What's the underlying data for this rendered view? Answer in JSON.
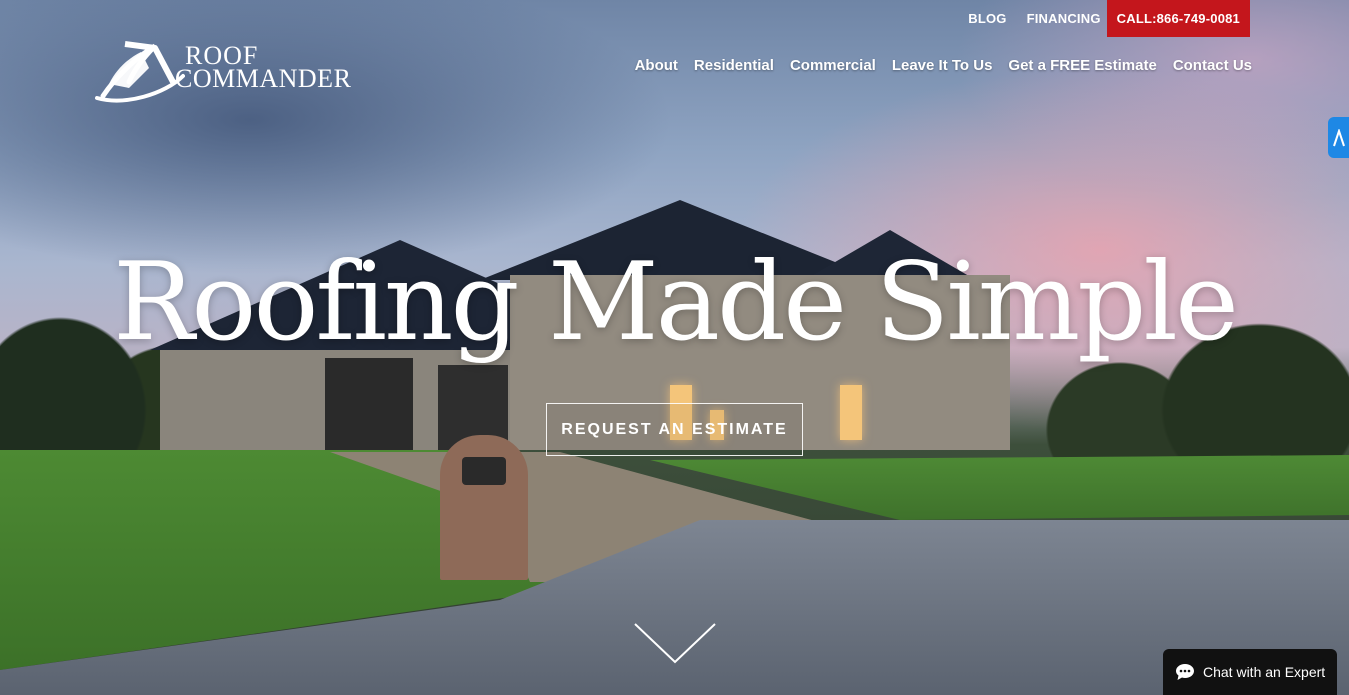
{
  "topbar": {
    "blog": "BLOG",
    "financing": "FINANCING",
    "call": "CALL:866-749-0081"
  },
  "logo": {
    "line1": "ROOF",
    "line2": "COMMANDER"
  },
  "nav": {
    "items": [
      "About",
      "Residential",
      "Commercial",
      "Leave It To Us",
      "Get a FREE Estimate",
      "Contact Us"
    ]
  },
  "hero": {
    "headline": "Roofing Made Simple",
    "cta": "REQUEST AN ESTIMATE"
  },
  "chat": {
    "label": "Chat with an Expert"
  },
  "colors": {
    "call_bg": "#c4161c",
    "side_tab": "#1e88e5",
    "chat_bg": "#111111"
  },
  "icons": [
    "chevron-down-icon",
    "chat-bubble-icon",
    "accessibility-icon",
    "roof-logo-icon"
  ]
}
